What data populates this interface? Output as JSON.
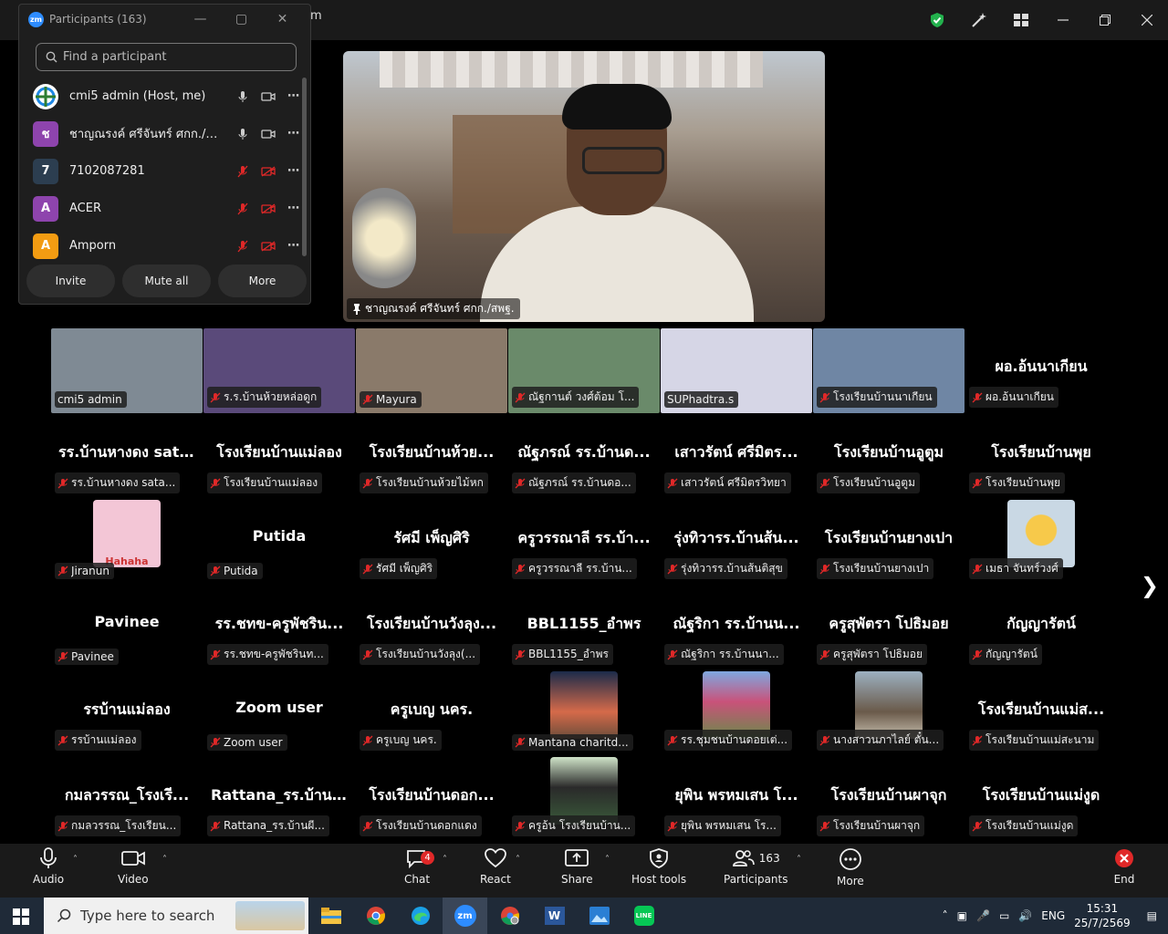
{
  "window": {
    "title_fragment": "m"
  },
  "speaker": {
    "name": "ชาญณรงค์ ศรีจันทร์ ศกก./สพฐ."
  },
  "panel": {
    "title": "Participants (163)",
    "search_placeholder": "Find a participant",
    "participants": [
      {
        "name": "cmi5 admin (Host, me)",
        "initial": "",
        "color": "#ffffff"
      },
      {
        "name": "ชาญณรงค์ ศรีจันทร์ ศกก./สพฐ.",
        "initial": "ช",
        "color": "#8e44ad"
      },
      {
        "name": "7102087281",
        "initial": "7",
        "color": "#2c3e50"
      },
      {
        "name": "ACER",
        "initial": "A",
        "color": "#8e44ad"
      },
      {
        "name": "Amporn",
        "initial": "A",
        "color": "#f39c12"
      }
    ],
    "buttons": {
      "invite": "Invite",
      "mute_all": "Mute all",
      "more": "More"
    }
  },
  "gallery": {
    "row0": [
      {
        "label": "cmi5 admin",
        "title": "",
        "muted": false,
        "bg": "#7f8a94"
      },
      {
        "label": "ร.ร.บ้านห้วยหล่อดูก",
        "title": "",
        "muted": true,
        "bg": "#5a4a7a"
      },
      {
        "label": "Mayura",
        "title": "",
        "muted": true,
        "bg": "#8a7a6a"
      },
      {
        "label": "ณัฐกานต์ วงศ์ต้อม โ...",
        "title": "",
        "muted": true,
        "bg": "#6a8a6a"
      },
      {
        "label": "SUPhadtra.s",
        "title": "",
        "muted": false,
        "bg": "#d6d6e6"
      },
      {
        "label": "โรงเรียนบ้านนาเกียน",
        "title": "",
        "muted": true,
        "bg": "#6f86a4"
      },
      {
        "label": "ผอ.อ้นนาเกียน",
        "title": "ผอ.อ้นนาเกียน",
        "muted": true,
        "bg": ""
      }
    ],
    "row1": [
      {
        "title": "รร.บ้านหางดง sat...",
        "label": "รร.บ้านหางดง sata..."
      },
      {
        "title": "โรงเรียนบ้านแม่ลอง",
        "label": "โรงเรียนบ้านแม่ลอง"
      },
      {
        "title": "โรงเรียนบ้านห้วย...",
        "label": "โรงเรียนบ้านห้วยไม้หก"
      },
      {
        "title": "ณัฐภรณ์ รร.บ้านด...",
        "label": "ณัฐภรณ์ รร.บ้านดอ..."
      },
      {
        "title": "เสาวรัตน์ ศรีมิตร...",
        "label": "เสาวรัตน์ ศรีมิตรวิทยา"
      },
      {
        "title": "โรงเรียนบ้านอูตูม",
        "label": "โรงเรียนบ้านอูตูม"
      },
      {
        "title": "โรงเรียนบ้านพุย",
        "label": "โรงเรียนบ้านพุย"
      }
    ],
    "row2": [
      {
        "title": "",
        "label": "Jiranun",
        "avatar": "cartoon",
        "avatar_text": "Hahaha"
      },
      {
        "title": "Putida",
        "label": "Putida"
      },
      {
        "title": "รัศมี เพ็ญศิริ",
        "label": "รัศมี เพ็ญศิริ"
      },
      {
        "title": "ครูวรรณาลี รร.บ้า...",
        "label": "ครูวรรณาลี รร.บ้าน..."
      },
      {
        "title": "รุ่งทิวารร.บ้านส้น...",
        "label": "รุ่งทิวารร.บ้านส้นติสุข"
      },
      {
        "title": "โรงเรียนบ้านยางเปา",
        "label": "โรงเรียนบ้านยางเปา"
      },
      {
        "title": "",
        "label": "เมธา จันทร์วงศ์",
        "avatar": "duck"
      }
    ],
    "row3": [
      {
        "title": "Pavinee",
        "label": "Pavinee"
      },
      {
        "title": "รร.ชทข-ครูพัชริน...",
        "label": "รร.ชทข-ครูพัชรินท..."
      },
      {
        "title": "โรงเรียนบ้านวังลุง...",
        "label": "โรงเรียนบ้านวังลุง(..."
      },
      {
        "title": "BBL1155_อำพร",
        "label": "BBL1155_อำพร"
      },
      {
        "title": "ณัฐริกา รร.บ้านน...",
        "label": "ณัฐริกา รร.บ้านนา..."
      },
      {
        "title": "ครูสุพัตรา โปธิมอย",
        "label": "ครูสุพัตรา โปธิมอย"
      },
      {
        "title": "กัญญารัตน์",
        "label": "กัญญารัตน์"
      }
    ],
    "row4": [
      {
        "title": "รรบ้านแม่ลอง",
        "label": "รรบ้านแม่ลอง"
      },
      {
        "title": "Zoom user",
        "label": "Zoom user"
      },
      {
        "title": "ครูเบญ นคร.",
        "label": "ครูเบญ นคร."
      },
      {
        "title": "",
        "label": "Mantana charitd...",
        "avatar": "flowers"
      },
      {
        "title": "",
        "label": "รร.ชุมชนบ้านดอยเต่...",
        "avatar": "tree"
      },
      {
        "title": "",
        "label": "นางสาวนภาไลย์ ตั๋น...",
        "avatar": "office"
      },
      {
        "title": "โรงเรียนบ้านแม่ส...",
        "label": "โรงเรียนบ้านแม่สะนาม"
      }
    ],
    "row5": [
      {
        "title": "กมลวรรณ_โรงเรี...",
        "label": "กมลวรรณ_โรงเรียน..."
      },
      {
        "title": "Rattana_รร.บ้าน...",
        "label": "Rattana_รร.บ้านผี..."
      },
      {
        "title": "โรงเรียนบ้านดอก...",
        "label": "โรงเรียนบ้านดอกแดง"
      },
      {
        "title": "",
        "label": "ครูอ้น โรงเรียนบ้าน...",
        "avatar": "girl"
      },
      {
        "title": "ยุพิน พรหมเสน โ...",
        "label": "ยุพิน พรหมเสน โร..."
      },
      {
        "title": "โรงเรียนบ้านผาจุก",
        "label": "โรงเรียนบ้านผาจุก"
      },
      {
        "title": "โรงเรียนบ้านแม่งูด",
        "label": "โรงเรียนบ้านแม่งูด"
      }
    ]
  },
  "toolbar": {
    "audio": "Audio",
    "video": "Video",
    "chat": "Chat",
    "chat_badge": "4",
    "react": "React",
    "share": "Share",
    "host_tools": "Host tools",
    "participants": "Participants",
    "participants_count": "163",
    "more": "More",
    "end": "End"
  },
  "taskbar": {
    "search_placeholder": "Type here to search",
    "lang": "ENG",
    "time": "15:31",
    "date": "25/7/2569"
  }
}
